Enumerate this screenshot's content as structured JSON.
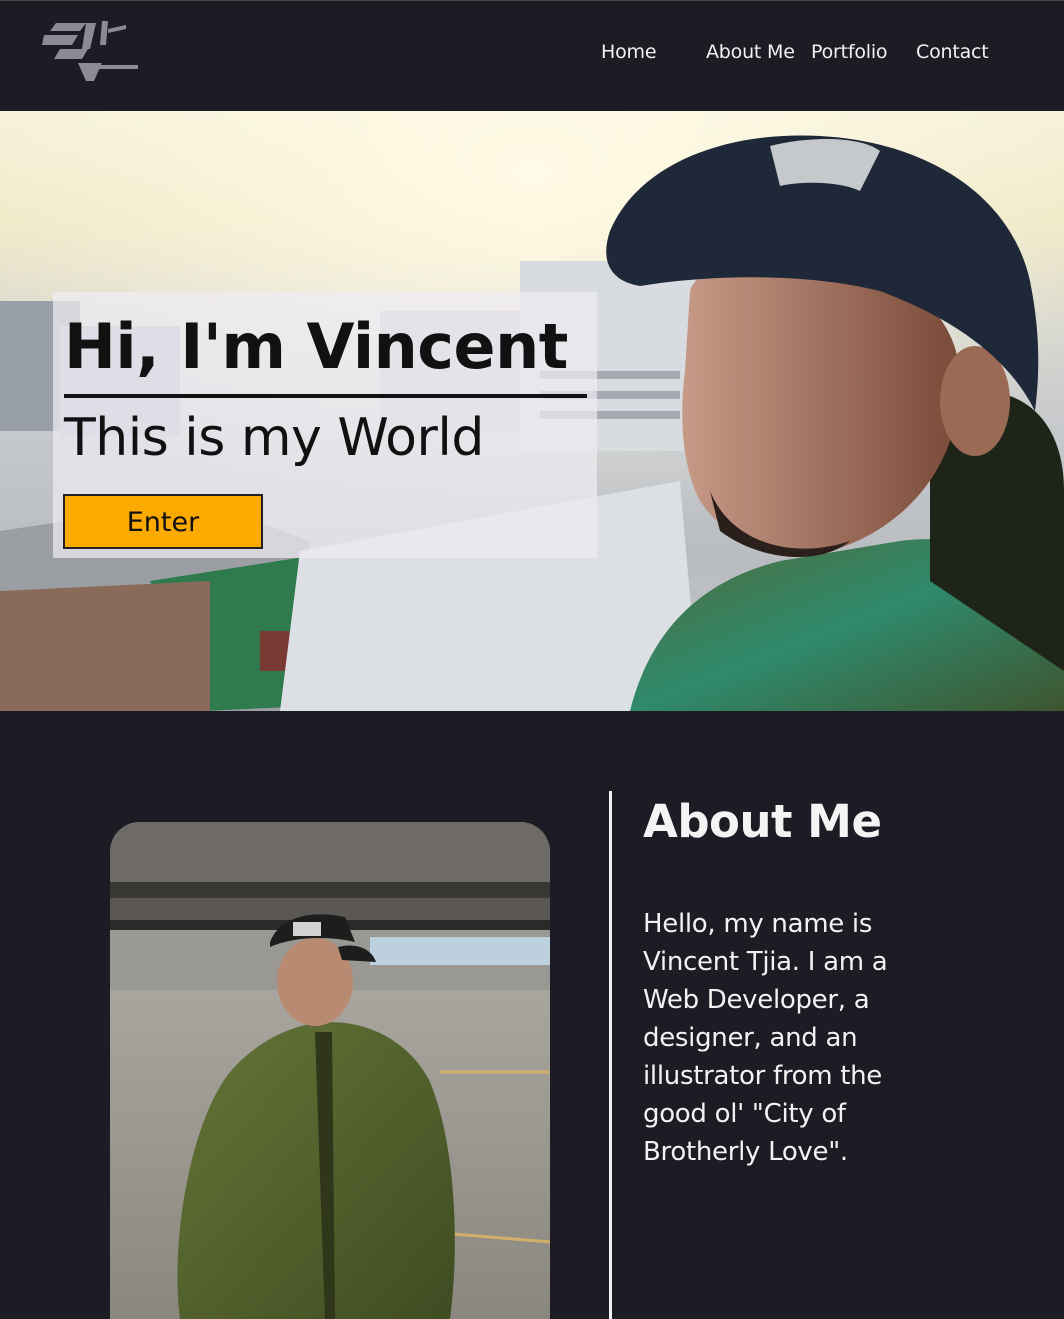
{
  "header": {
    "logo_alt": "VT logo",
    "nav": [
      {
        "label": "Home"
      },
      {
        "label": "About Me"
      },
      {
        "label": "Portfolio"
      },
      {
        "label": "Contact"
      }
    ]
  },
  "hero": {
    "title": "Hi, I'm Vincent",
    "subtitle": "This is my World",
    "button_label": "Enter",
    "image": "photo-vincent-rooftop"
  },
  "about": {
    "heading": "About Me",
    "body": "Hello, my name is Vincent Tjia. I am a Web Developer, a designer, and an illustrator from the good ol' \"City of Brotherly Love\".",
    "image": "photo-vincent-parking-garage"
  },
  "colors": {
    "background": "#1b1c24",
    "accent": "#fca900",
    "text_light": "#f2f2f2"
  }
}
